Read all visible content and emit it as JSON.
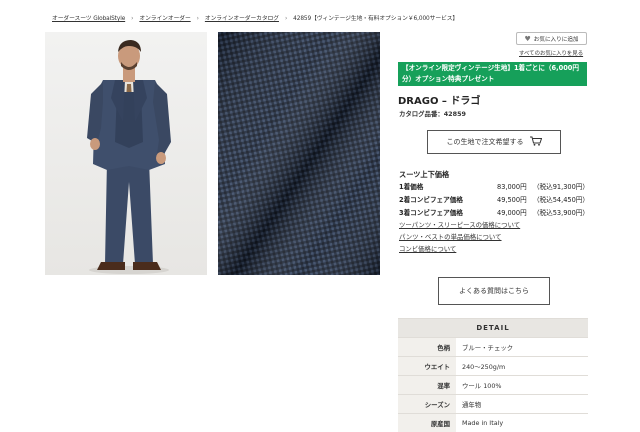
{
  "breadcrumb": {
    "items": [
      "オーダースーツ GlobalStyle",
      "オンラインオーダー",
      "オンラインオーダーカタログ"
    ],
    "current": "42859【ヴィンテージ生地・有料オプション￥6,000サービス】"
  },
  "favorites": {
    "button_label": "お気に入りに追加",
    "link_label": "すべてのお気に入りを見る"
  },
  "promo": {
    "text": "【オンライン限定ヴィンテージ生地】1着ごとに（6,000円分）オプション特典プレゼント",
    "color": "#16a05a"
  },
  "product": {
    "title": "DRAGO – ドラゴ",
    "catalog_number": "カタログ品番：42859"
  },
  "order_button": {
    "label": "この生地で注文希望する",
    "icon": "cart-icon"
  },
  "prices": {
    "heading": "スーツ上下価格",
    "rows": [
      {
        "label": "1着価格",
        "price": "83,000円",
        "tax": "（税込91,300円）"
      },
      {
        "label": "2着コンビフェア価格",
        "price": "49,500円",
        "tax": "（税込54,450円）"
      },
      {
        "label": "3着コンビフェア価格",
        "price": "49,000円",
        "tax": "（税込53,900円）"
      }
    ]
  },
  "links": [
    "ツーパンツ・スリーピースの価格について",
    "パンツ・ベストの単品価格について",
    "コンビ価格について"
  ],
  "faq_button": {
    "label": "よくある質問はこちら"
  },
  "detail": {
    "heading": "DETAIL",
    "rows": [
      {
        "key": "色柄",
        "value": "ブルー・チェック"
      },
      {
        "key": "ウエイト",
        "value": "240～250g/m"
      },
      {
        "key": "混率",
        "value": "ウール 100%"
      },
      {
        "key": "シーズン",
        "value": "通年物"
      },
      {
        "key": "原産国",
        "value": "Made in Italy"
      }
    ]
  }
}
